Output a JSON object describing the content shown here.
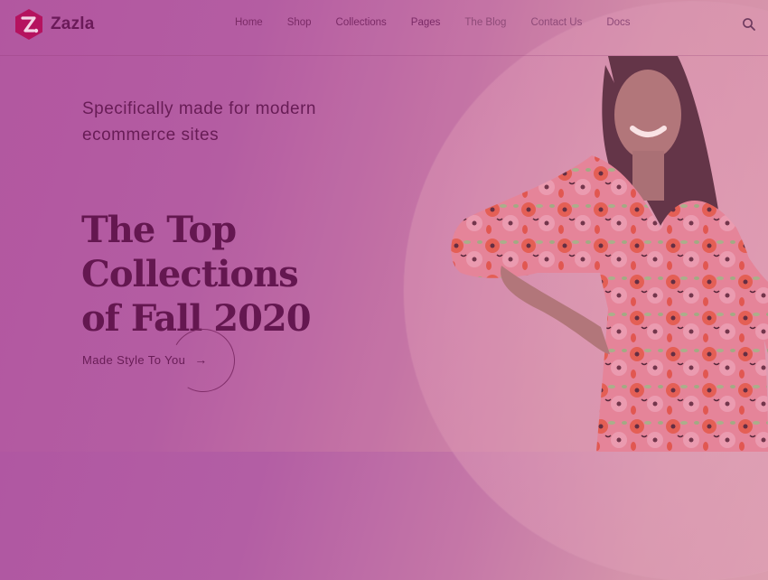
{
  "brand": {
    "name": "Zazla",
    "logo_glyph": "Z.",
    "logo_icon": "hexagon-logo-icon",
    "accent_color": "#b5125f"
  },
  "nav": {
    "items": [
      {
        "label": "Home"
      },
      {
        "label": "Shop"
      },
      {
        "label": "Collections"
      },
      {
        "label": "Pages"
      },
      {
        "label": "The Blog"
      },
      {
        "label": "Contact Us"
      },
      {
        "label": "Docs"
      }
    ],
    "search_icon": "search-icon"
  },
  "hero": {
    "subtitle": "Specifically made for modern ecommerce sites",
    "title_line1": "The Top Collections",
    "title_line2": "of Fall 2020",
    "cta_label": "Made Style To You",
    "cta_arrow": "→",
    "image_alt": "Smiling woman in a red and pink floral dress"
  },
  "colors": {
    "text_dark": "#5a1049",
    "bg_left": "#b057a2",
    "bg_right": "#dfa3b1"
  }
}
